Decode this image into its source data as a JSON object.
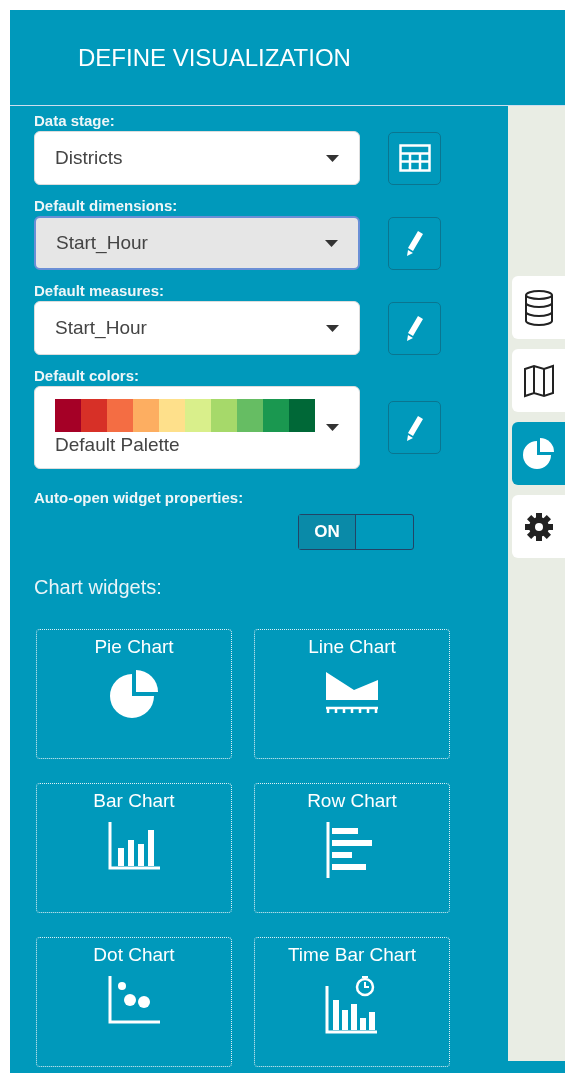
{
  "header": {
    "title": "DEFINE VISUALIZATION"
  },
  "fields": [
    {
      "label": "Data stage:",
      "value": "Districts",
      "kind": "select",
      "focused": false,
      "button": {
        "kind": "table"
      }
    },
    {
      "label": "Default dimensions:",
      "value": "Start_Hour",
      "kind": "select",
      "focused": true,
      "button": {
        "kind": "edit"
      }
    },
    {
      "label": "Default measures:",
      "value": "Start_Hour",
      "kind": "select",
      "focused": false,
      "button": {
        "kind": "edit"
      }
    },
    {
      "label": "Default colors:",
      "value": "Default Palette",
      "kind": "palette",
      "focused": false,
      "button": {
        "kind": "edit"
      },
      "palette": [
        {
          "color": "#a50026"
        },
        {
          "color": "#d73027"
        },
        {
          "color": "#f46d43"
        },
        {
          "color": "#fdae61"
        },
        {
          "color": "#fee08b"
        },
        {
          "color": "#d9ef8b"
        },
        {
          "color": "#a6d96a"
        },
        {
          "color": "#66bd63"
        },
        {
          "color": "#1a9850"
        },
        {
          "color": "#006837"
        }
      ]
    }
  ],
  "auto_open": {
    "label": "Auto-open widget properties:",
    "on": true,
    "on_text": "ON"
  },
  "widgets_heading": "Chart widgets:",
  "widgets": [
    {
      "label": "Pie Chart",
      "kind": "pie"
    },
    {
      "label": "Line Chart",
      "kind": "line"
    },
    {
      "label": "Bar Chart",
      "kind": "bar"
    },
    {
      "label": "Row Chart",
      "kind": "row"
    },
    {
      "label": "Dot Chart",
      "kind": "dot"
    },
    {
      "label": "Time Bar Chart",
      "kind": "timebar"
    }
  ],
  "side_tools": [
    {
      "kind": "database",
      "selected": false
    },
    {
      "kind": "map",
      "selected": false
    },
    {
      "kind": "pie",
      "selected": true
    },
    {
      "kind": "settings",
      "selected": false
    }
  ]
}
